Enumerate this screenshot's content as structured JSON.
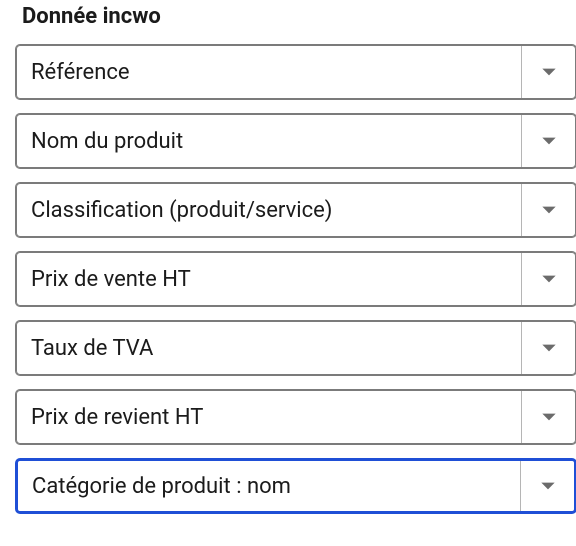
{
  "column": {
    "header": "Donnée incwo",
    "rows": [
      {
        "value": "Référence",
        "focused": false
      },
      {
        "value": "Nom du produit",
        "focused": false
      },
      {
        "value": "Classification (produit/service)",
        "focused": false
      },
      {
        "value": "Prix de vente HT",
        "focused": false
      },
      {
        "value": "Taux de TVA",
        "focused": false
      },
      {
        "value": "Prix de revient HT",
        "focused": false
      },
      {
        "value": "Catégorie de produit : nom",
        "focused": true
      }
    ]
  }
}
